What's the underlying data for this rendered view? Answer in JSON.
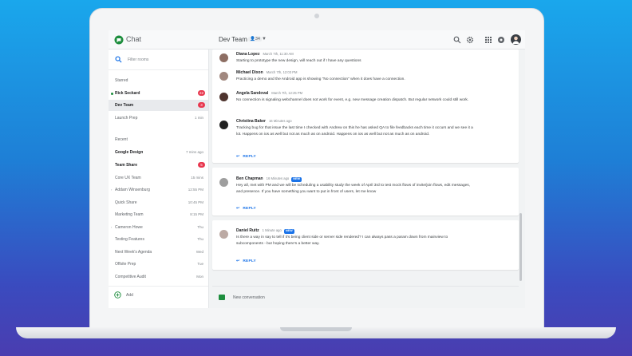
{
  "app": {
    "title": "Chat"
  },
  "room": {
    "title": "Dev Team",
    "member_count": "34"
  },
  "search": {
    "placeholder": "Filter rooms"
  },
  "sidebar": {
    "starred_label": "Starred",
    "starred": [
      {
        "name": "Rick Seckard",
        "badge": "22",
        "bold": true,
        "online": true
      },
      {
        "name": "Dev Team",
        "badge": "3",
        "bold": true,
        "active": true
      },
      {
        "name": "Launch Prep",
        "time": "1 min"
      }
    ],
    "recent_label": "Recent",
    "recent": [
      {
        "name": "Google Design",
        "time": "7 mins ago",
        "bold": true
      },
      {
        "name": "Team Share",
        "badge": "5",
        "bold": true
      },
      {
        "name": "Core UX Team",
        "time": "15 mins"
      },
      {
        "name": "Addam Winsenburg",
        "time": "12:55 PM"
      },
      {
        "name": "Quick Share",
        "time": "10:45 PM"
      },
      {
        "name": "Marketing Team",
        "time": "8:15 PM"
      },
      {
        "name": "Cameron Howe",
        "time": "Thu"
      },
      {
        "name": "Testing Features",
        "time": "Thu"
      },
      {
        "name": "Next Week's Agenda",
        "time": "Wed"
      },
      {
        "name": "Offsite Prep",
        "time": "Tue"
      },
      {
        "name": "Competitive Audit",
        "time": "Mon"
      }
    ],
    "add_label": "Add"
  },
  "messages": {
    "m1": {
      "author": "Diana Lopez",
      "time": "March 7th, 11:30 AM",
      "text": "Starting to prototype the new design, will reach out if I have any questions"
    },
    "m2": {
      "author": "Michael Dixon",
      "time": "March 7th, 12:03 PM",
      "text": "Practicing a demo and the Android app is showing \"No connection\" when it does have a connection."
    },
    "m3": {
      "author": "Angela Sandoval",
      "time": "March 7th, 12:25 PM",
      "text": "No connection is signaling webchannel does not work for event, e.g. new message creation dispatch. But regular network could still work."
    },
    "m4": {
      "author": "Christina Baker",
      "time": "16 Minutes ago",
      "text": "Tracking bug for that issue the last time I checked with Andrew on this he has asked QA to file feedbacks each time it occurs and we see it a lot. Happens on ios as well but not as much as on android. Happens on ios as well but not as much as on android."
    },
    "m5": {
      "author": "Ben Chapman",
      "time": "16 Minutes ago",
      "new": "NEW",
      "text": "Hey all, met with PM and we will be scheduling a usability study the week of April 3rd to test mock flows of invite/join flows, edit messages, and presence. If you have something you want to put in front of users, let me know"
    },
    "m6": {
      "author": "Daniel Ruitz",
      "time": "1 Minute ago",
      "new": "NEW",
      "text": "Is there a way in say to tell if it's being client side or server side rendered? I can always pass a param down from mainview to subcomponents - but hoping there's a better way."
    }
  },
  "reply_label": "REPLY",
  "composer": {
    "placeholder": "New conversation"
  },
  "colors": {
    "accent": "#1a73e8",
    "badge": "#e8384f",
    "brand": "#1e8e3e"
  }
}
